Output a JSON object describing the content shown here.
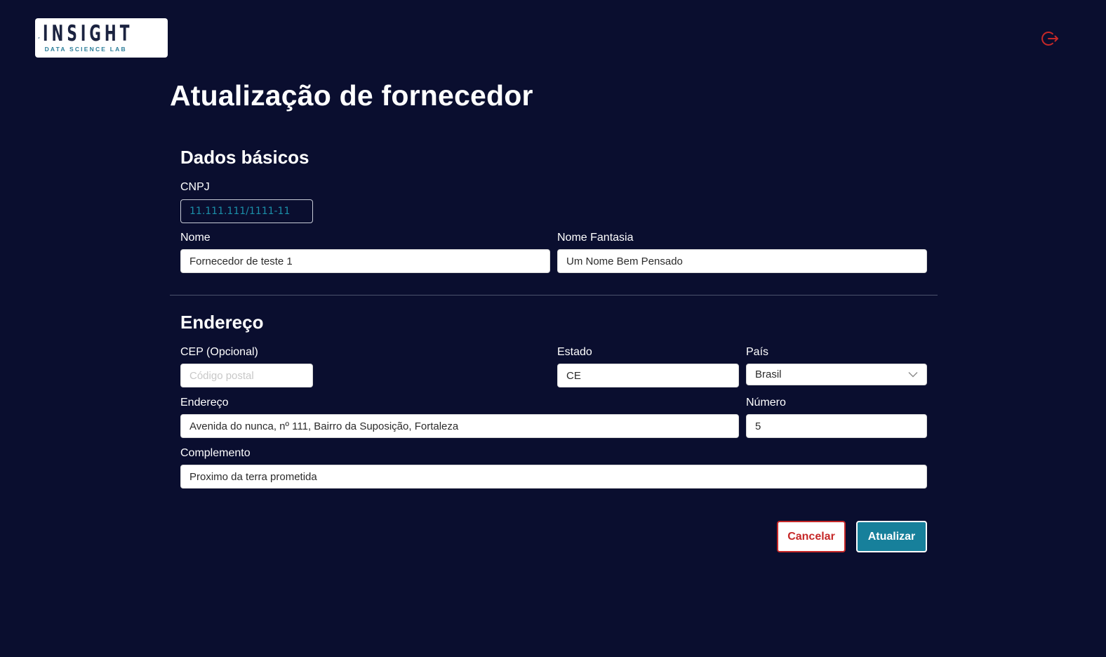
{
  "header": {
    "logo_word": "INSIGHT",
    "logo_sub": "DATA SCIENCE LAB",
    "logout_icon": "logout-icon"
  },
  "page": {
    "title": "Atualização de fornecedor"
  },
  "basic": {
    "section_title": "Dados básicos",
    "cnpj_label": "CNPJ",
    "cnpj_value": "11.111.111/1111-11",
    "nome_label": "Nome",
    "nome_value": "Fornecedor de teste 1",
    "fantasia_label": "Nome Fantasia",
    "fantasia_value": "Um Nome Bem Pensado"
  },
  "address": {
    "section_title": "Endereço",
    "cep_label": "CEP (Opcional)",
    "cep_value": "",
    "cep_placeholder": "Código postal",
    "estado_label": "Estado",
    "estado_value": "CE",
    "pais_label": "País",
    "pais_value": "Brasil",
    "endereco_label": "Endereço",
    "endereco_value": "Avenida do nunca, nº 111, Bairro da Suposição, Fortaleza",
    "numero_label": "Número",
    "numero_value": "5",
    "complemento_label": "Complemento",
    "complemento_value": "Proximo da terra prometida"
  },
  "actions": {
    "cancel_label": "Cancelar",
    "update_label": "Atualizar"
  },
  "colors": {
    "background": "#0a0e2f",
    "accent": "#17809b",
    "danger": "#c62828"
  }
}
